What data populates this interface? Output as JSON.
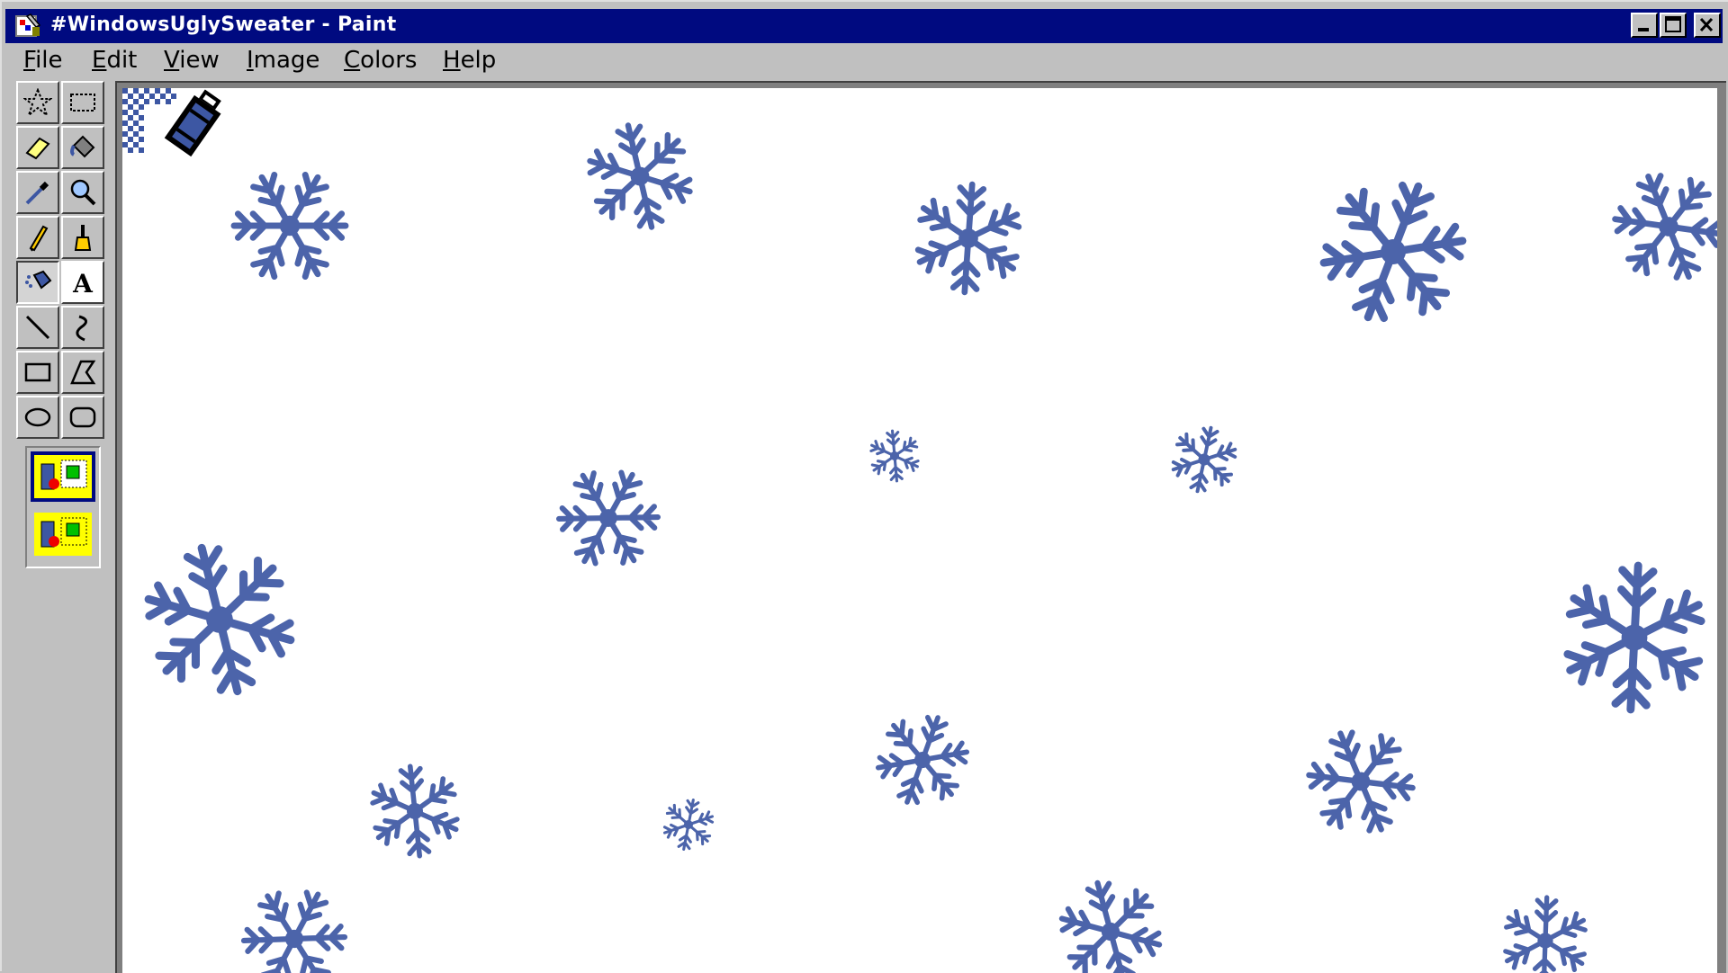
{
  "window": {
    "title": "#WindowsUglySweater - Paint"
  },
  "menu": [
    {
      "label": "File",
      "accel": "F",
      "rest": "ile"
    },
    {
      "label": "Edit",
      "accel": "E",
      "rest": "dit"
    },
    {
      "label": "View",
      "accel": "V",
      "rest": "iew"
    },
    {
      "label": "Image",
      "accel": "I",
      "rest": "mage"
    },
    {
      "label": "Colors",
      "accel": "C",
      "rest": "olors"
    },
    {
      "label": "Help",
      "accel": "H",
      "rest": "elp"
    }
  ],
  "tools": [
    {
      "name": "free-form-select-icon"
    },
    {
      "name": "rect-select-icon"
    },
    {
      "name": "eraser-icon"
    },
    {
      "name": "fill-icon"
    },
    {
      "name": "color-picker-icon"
    },
    {
      "name": "magnifier-icon"
    },
    {
      "name": "pencil-icon"
    },
    {
      "name": "brush-icon"
    },
    {
      "name": "airbrush-icon",
      "selected": true
    },
    {
      "name": "text-icon",
      "glyph": "A"
    },
    {
      "name": "line-icon"
    },
    {
      "name": "curve-icon"
    },
    {
      "name": "rectangle-icon"
    },
    {
      "name": "polygon-icon"
    },
    {
      "name": "ellipse-icon"
    },
    {
      "name": "rounded-rect-icon"
    }
  ],
  "options": [
    {
      "name": "opaque-option",
      "selected": true
    },
    {
      "name": "transparent-option",
      "selected": false
    }
  ],
  "colors": {
    "titlebar": "#000a80",
    "snowflake": "#3d57a3",
    "canvas": "#ffffff",
    "chrome": "#c0c0c0"
  }
}
